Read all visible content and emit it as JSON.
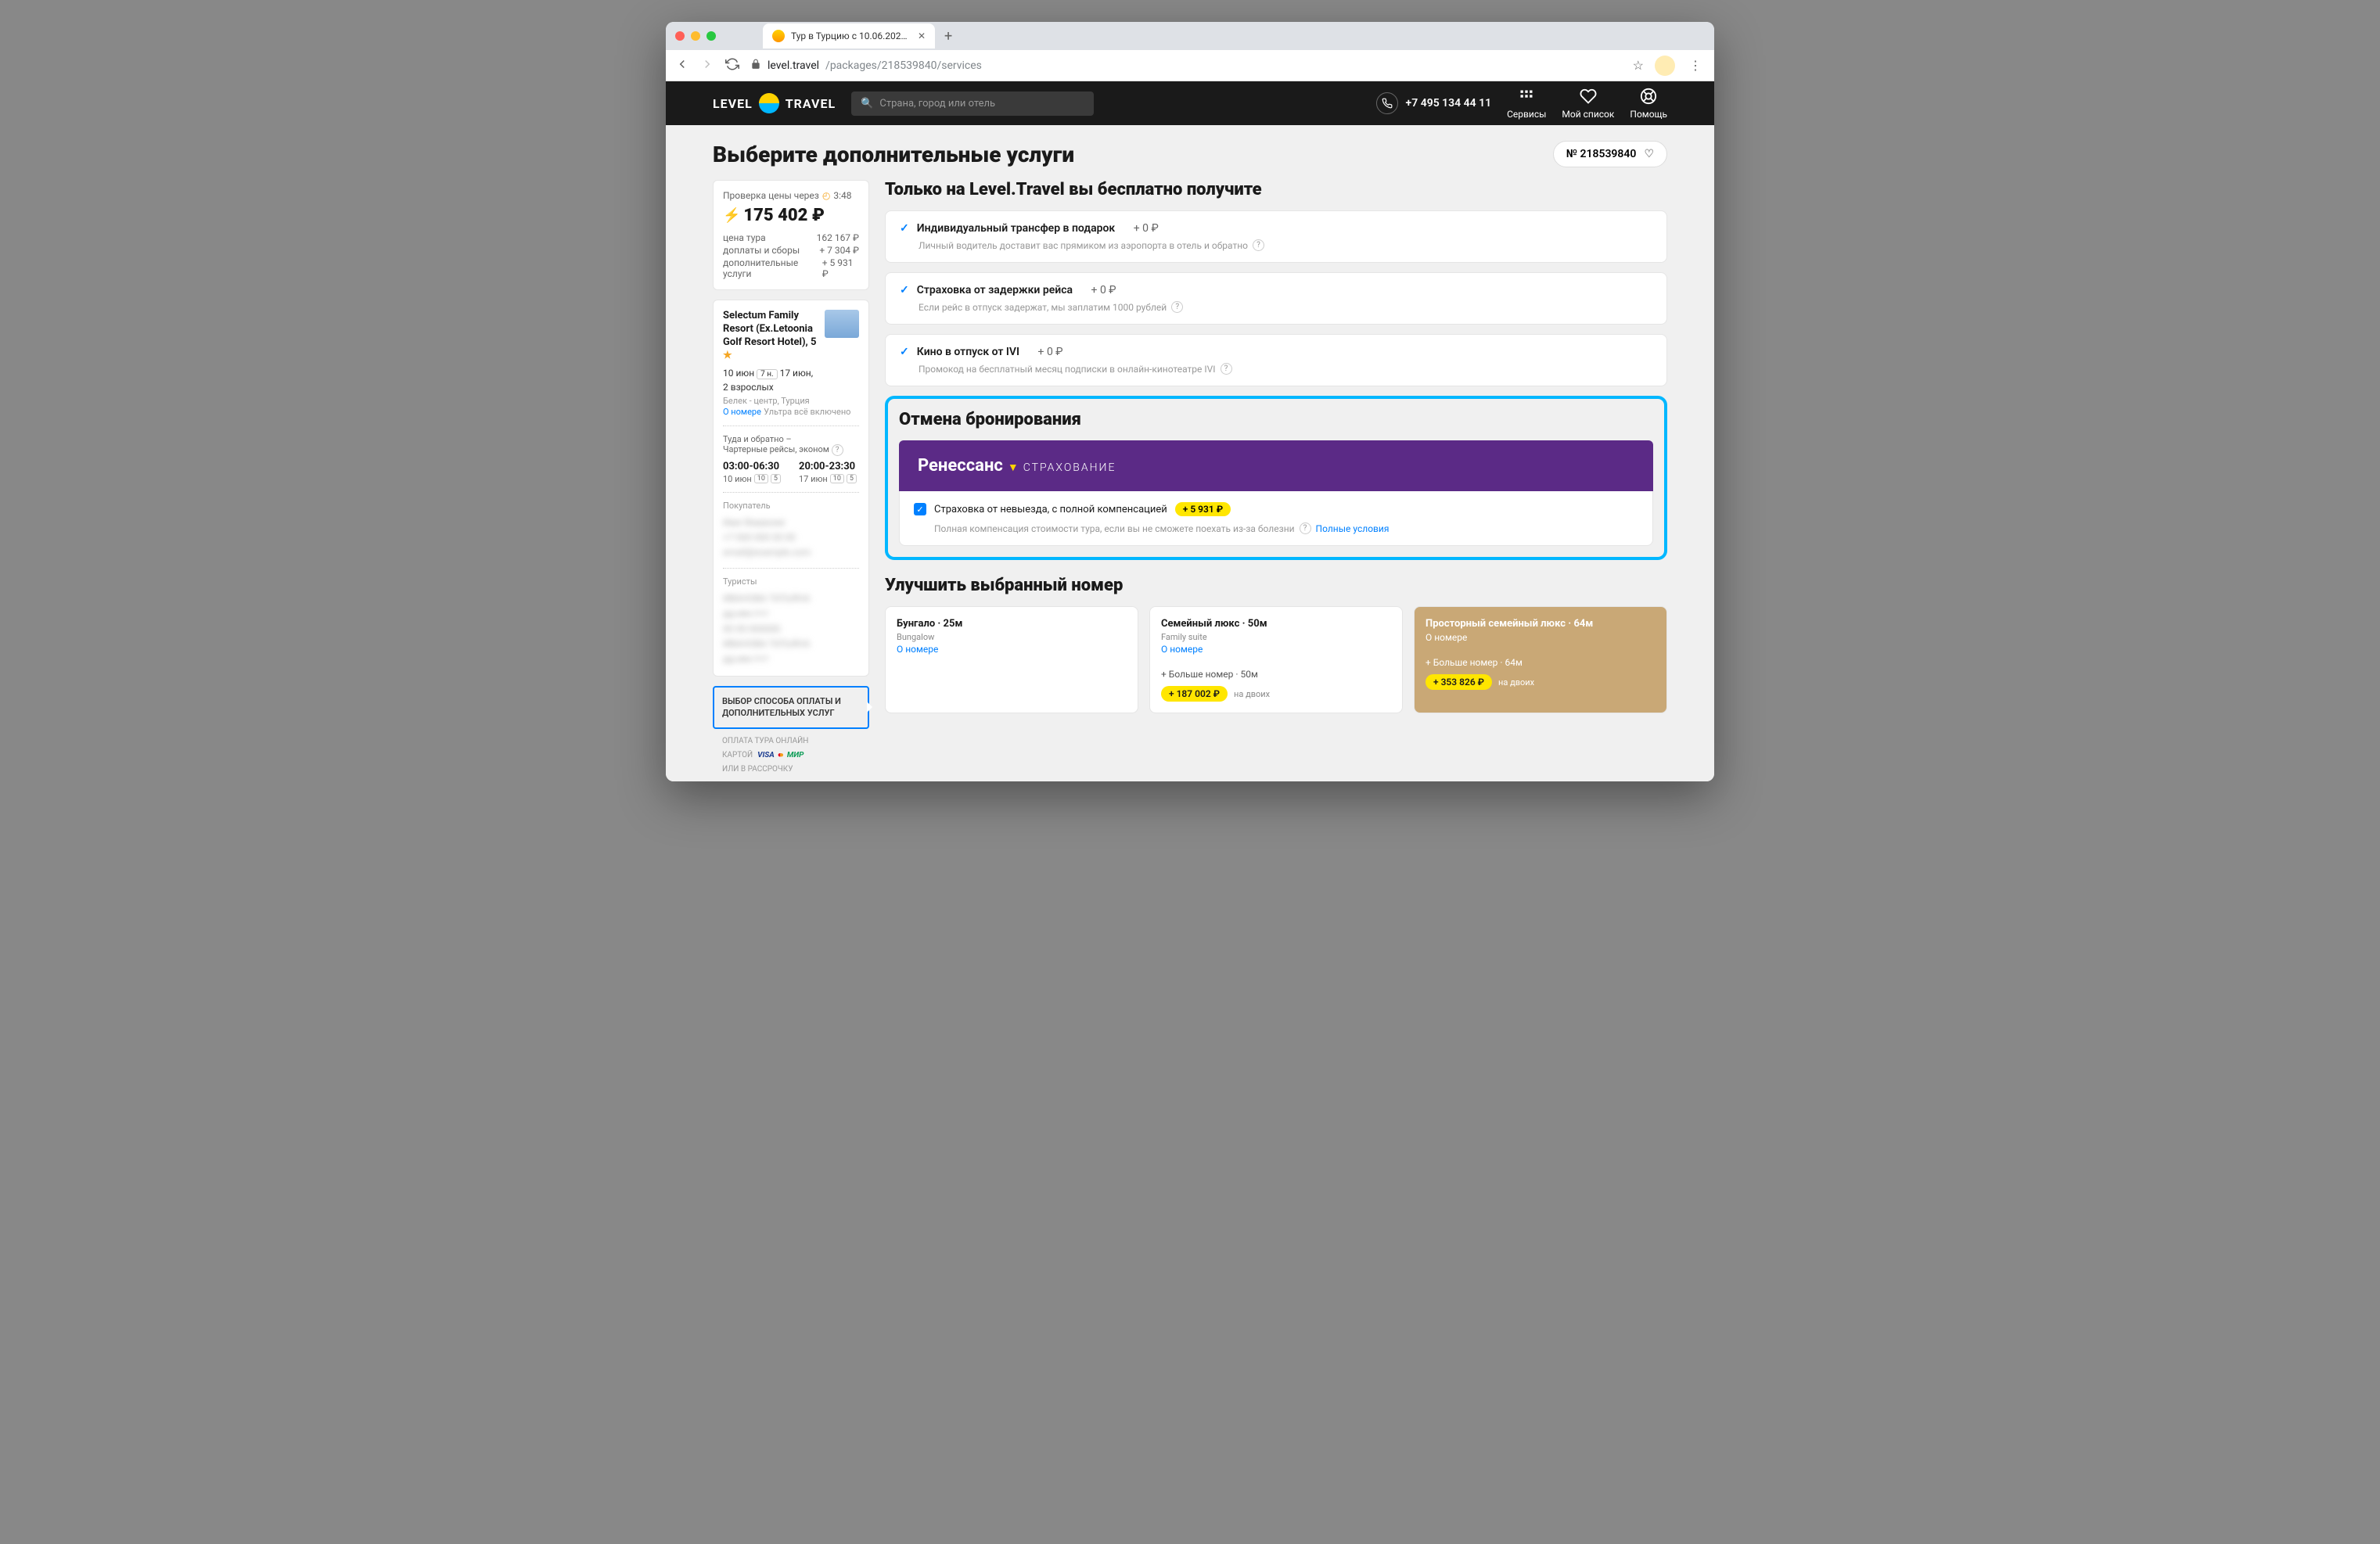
{
  "browser": {
    "tab_title": "Тур в Турцию с 10.06.2021 на...",
    "url_host": "level.travel",
    "url_path": "/packages/218539840/services"
  },
  "header": {
    "logo_left": "LEVEL",
    "logo_right": "TRAVEL",
    "search_placeholder": "Страна, город или отель",
    "phone": "+7 495 134 44 11",
    "links": {
      "services": "Сервисы",
      "wishlist": "Мой список",
      "help": "Помощь"
    }
  },
  "page": {
    "title": "Выберите дополнительные услуги",
    "order_number": "№ 218539840"
  },
  "sidebar": {
    "check_label": "Проверка цены через",
    "check_timer": "3:48",
    "total": "175 402 ₽",
    "rows": [
      {
        "label": "цена тура",
        "value": "162 167 ₽"
      },
      {
        "label": "доплаты и сборы",
        "value": "+ 7 304 ₽"
      },
      {
        "label": "дополнительные услуги",
        "value": "+ 5 931 ₽"
      }
    ],
    "hotel_name": "Selectum Family Resort (Ex.Letoonia Golf Resort Hotel), 5",
    "dates": "10 июн",
    "nights": "7 н.",
    "dates_end": "17 июн,",
    "guests": "2 взрослых",
    "location": "Белек - центр, Турция",
    "room_link": "О номере",
    "meal": "Ультра всё включено",
    "flight_label": "Туда и обратно –",
    "flight_type": "Чартерные рейсы, эконом",
    "dep_time": "03:00-06:30",
    "dep_date": "10 июн",
    "ret_time": "20:00-23:30",
    "ret_date": "17 июн",
    "baggage_badges": [
      "10",
      "5"
    ],
    "buyer_label": "Покупатель",
    "tourists_label": "Туристы",
    "step_active": "ВЫБОР СПОСОБА ОПЛАТЫ И ДОПОЛНИТЕЛЬНЫХ УСЛУГ",
    "pay_line1": "ОПЛАТА ТУРА ОНЛАЙН",
    "pay_line2": "КАРТОЙ",
    "pay_line3": "ИЛИ В РАССРОЧКУ"
  },
  "free_section": {
    "title": "Только на Level.Travel вы бесплатно получите",
    "items": [
      {
        "title": "Индивидуальный трансфер в подарок",
        "price": "+ 0 ₽",
        "desc": "Личный водитель доставит вас прямиком из аэропорта в отель и обратно"
      },
      {
        "title": "Страховка от задержки рейса",
        "price": "+ 0 ₽",
        "desc": "Если рейс в отпуск задержат, мы заплатим 1000 рублей"
      },
      {
        "title": "Кино в отпуск от IVI",
        "price": "+ 0 ₽",
        "desc": "Промокод на бесплатный месяц подписки в онлайн-кинотеатре IVI"
      }
    ]
  },
  "cancel_section": {
    "title": "Отмена бронирования",
    "brand": "Ренессанс",
    "brand_sub": "СТРАХОВАНИЕ",
    "item_title": "Страховка от невыезда, с полной компенсацией",
    "item_price": "+ 5 931 ₽",
    "item_desc": "Полная компенсация стоимости тура, если вы не сможете поехать из-за болезни",
    "terms_link": "Полные условия"
  },
  "rooms_section": {
    "title": "Улучшить выбранный номер",
    "cards": [
      {
        "title": "Бунгало · 25м",
        "sub": "Bungalow",
        "link": "О номере"
      },
      {
        "title": "Семейный люкс · 50м",
        "sub": "Family suite",
        "link": "О номере",
        "feat": "+ Больше номер · 50м",
        "price": "+ 187 002 ₽",
        "per": "на двоих"
      },
      {
        "title": "Просторный семейный люкс · 64м",
        "sub": "",
        "link": "О номере",
        "feat": "+ Больше номер · 64м",
        "price": "+ 353 826 ₽",
        "per": "на двоих"
      }
    ]
  }
}
